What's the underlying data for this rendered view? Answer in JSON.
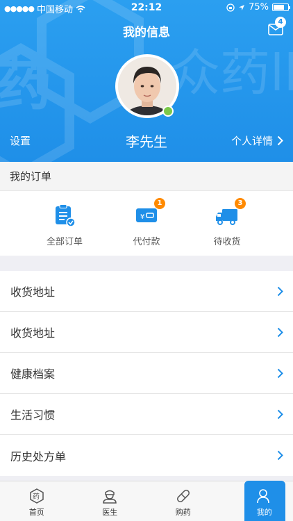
{
  "status_bar": {
    "carrier": "中国移动",
    "time": "22:12",
    "battery": "75%",
    "battery_level": 0.75
  },
  "header": {
    "title": "我的信息",
    "mail_badge": "4",
    "settings_label": "设置",
    "username": "李先生",
    "details_label": "个人详情"
  },
  "orders": {
    "section_title": "我的订单",
    "items": [
      {
        "label": "全部订单",
        "badge": ""
      },
      {
        "label": "代付款",
        "badge": "1"
      },
      {
        "label": "待收货",
        "badge": "3"
      }
    ]
  },
  "menu": [
    {
      "label": "收货地址"
    },
    {
      "label": "收货地址"
    },
    {
      "label": "健康档案"
    },
    {
      "label": "生活习惯"
    },
    {
      "label": "历史处方单"
    }
  ],
  "tabbar": [
    {
      "label": "首页",
      "icon": "home-pill-icon"
    },
    {
      "label": "医生",
      "icon": "doctor-icon"
    },
    {
      "label": "购药",
      "icon": "capsule-icon"
    },
    {
      "label": "我的",
      "icon": "profile-icon"
    }
  ],
  "colors": {
    "primary": "#1f8fe8",
    "badge": "#ff8a00",
    "online": "#7cc84a"
  }
}
